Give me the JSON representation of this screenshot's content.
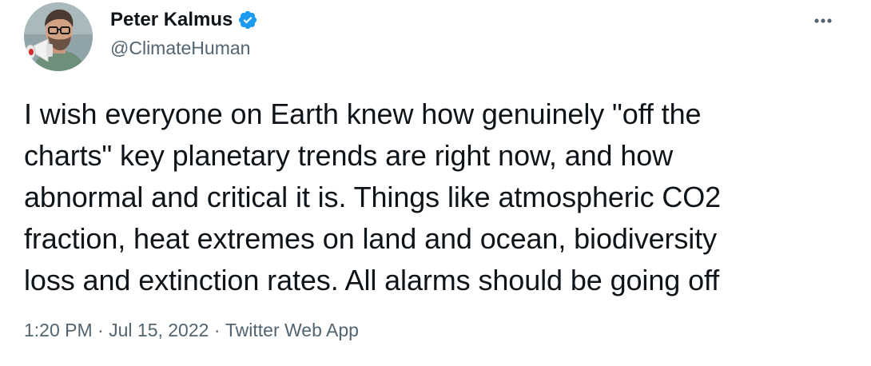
{
  "author": {
    "name": "Peter Kalmus",
    "handle": "@ClimateHuman",
    "verified": true,
    "verified_badge_color": "#1d9bf0"
  },
  "icons": {
    "verified": "verified-badge-icon",
    "more": "more-options-icon"
  },
  "tweet": {
    "text": "I wish everyone on Earth knew how genuinely \"off the\ncharts\" key planetary trends are right now, and how\nabnormal and critical it is. Things like atmospheric CO2\nfraction, heat extremes on land and ocean, biodiversity\nloss and extinction rates. All alarms should be going off",
    "time": "1:20 PM",
    "separator": " · ",
    "date": "Jul 15, 2022",
    "source": "Twitter Web App"
  },
  "colors": {
    "text_primary": "#0f1419",
    "text_secondary": "#536471",
    "accent": "#1d9bf0"
  }
}
